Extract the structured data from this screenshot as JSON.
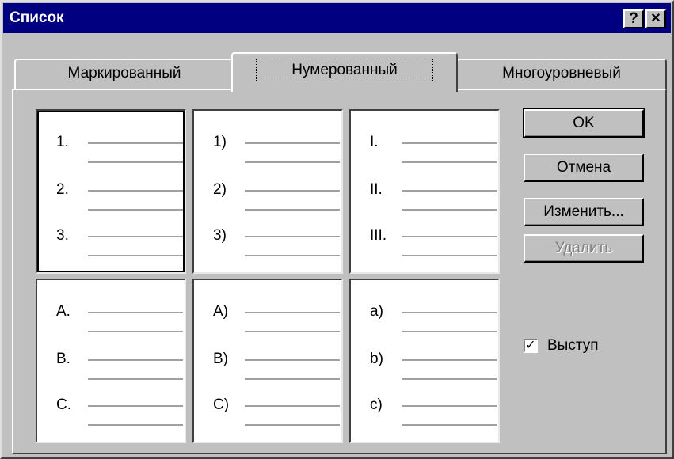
{
  "window": {
    "title": "Список",
    "help_label": "?",
    "close_label": "✕"
  },
  "tabs": [
    {
      "label": "Маркированный",
      "active": false
    },
    {
      "label": "Нумерованный",
      "active": true
    },
    {
      "label": "Многоуровневый",
      "active": false
    }
  ],
  "styles": [
    {
      "markers": [
        "1.",
        "2.",
        "3."
      ]
    },
    {
      "markers": [
        "1)",
        "2)",
        "3)"
      ]
    },
    {
      "markers": [
        "I.",
        "II.",
        "III."
      ]
    },
    {
      "markers": [
        "A.",
        "B.",
        "C."
      ]
    },
    {
      "markers": [
        "A)",
        "B)",
        "C)"
      ]
    },
    {
      "markers": [
        "a)",
        "b)",
        "c)"
      ]
    }
  ],
  "buttons": {
    "ok": "OK",
    "cancel": "Отмена",
    "modify": "Изменить...",
    "delete": "Удалить"
  },
  "hanging_indent": {
    "label": "Выступ",
    "checked": true,
    "check_glyph": "✓"
  },
  "colors": {
    "titlebar": "#000080",
    "face": "#c0c0c0",
    "disabled_text": "#808080"
  }
}
